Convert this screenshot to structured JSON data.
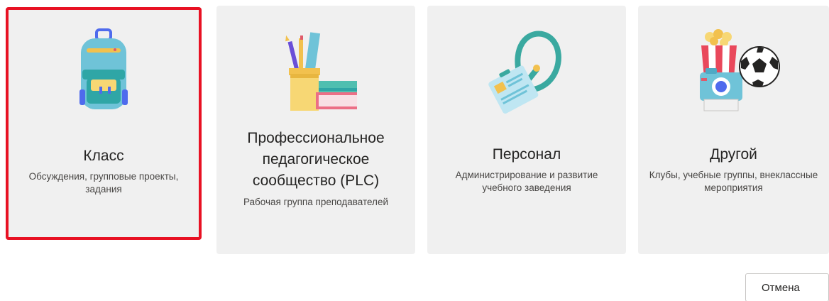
{
  "cards": [
    {
      "title": "Класс",
      "description": "Обсуждения, групповые проекты, задания",
      "icon": "backpack-icon",
      "selected": true
    },
    {
      "title": "Профессиональное педагогическое сообщество (PLC)",
      "description": "Рабочая группа преподавателей",
      "icon": "pencil-cup-books-icon",
      "selected": false
    },
    {
      "title": "Персонал",
      "description": "Администрирование и развитие учебного заведения",
      "icon": "id-badge-lanyard-icon",
      "selected": false
    },
    {
      "title": "Другой",
      "description": "Клубы, учебные группы, внеклассные мероприятия",
      "icon": "popcorn-camera-ball-icon",
      "selected": false
    }
  ],
  "footer": {
    "cancel_label": "Отмена"
  },
  "colors": {
    "card_bg": "#f0f0f0",
    "selection_outline": "#e81123",
    "text_primary": "#252423",
    "text_secondary": "#484644"
  }
}
